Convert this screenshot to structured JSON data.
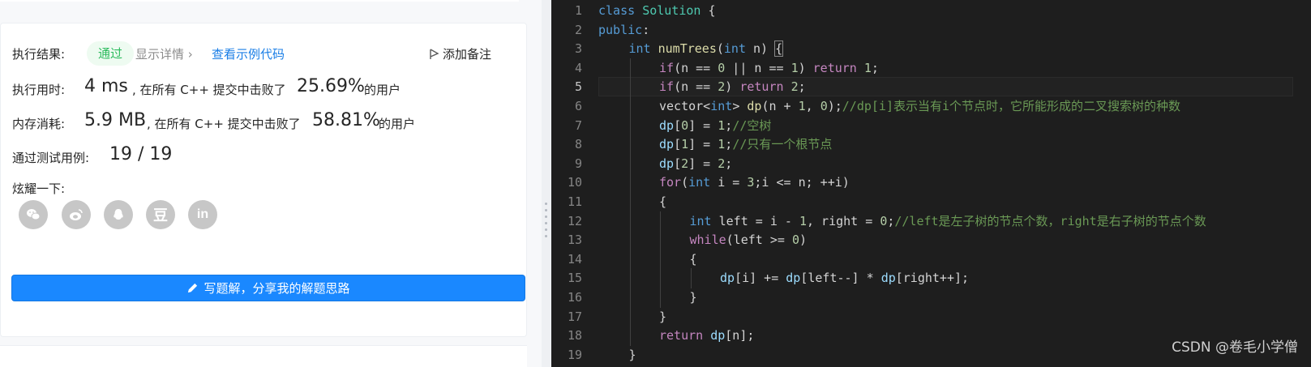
{
  "result": {
    "status_label": "执行结果:",
    "status_value": "通过",
    "details_link": "显示详情",
    "sample_code_link": "查看示例代码",
    "add_note": "添加备注",
    "runtime_label": "执行用时:",
    "runtime_value": "4 ms",
    "runtime_beat_text": ", 在所有 C++ 提交中击败了",
    "runtime_percent": "25.69%",
    "runtime_suffix": "的用户",
    "memory_label": "内存消耗:",
    "memory_value": "5.9 MB",
    "memory_beat_text": ", 在所有 C++ 提交中击败了",
    "memory_percent": "58.81%",
    "memory_suffix": "的用户",
    "tests_label": "通过测试用例:",
    "tests_value": "19 / 19",
    "share_label": "炫耀一下:",
    "share_icons": [
      "wechat-icon",
      "weibo-icon",
      "qq-icon",
      "douban-icon",
      "linkedin-icon"
    ],
    "share_douban_char": "豆",
    "share_linkedin_text": "in",
    "write_solution_button": "写题解，分享我的解题思路"
  },
  "editor": {
    "watermark": "CSDN @卷毛小学僧",
    "colors": {
      "background": "#1e1e1e",
      "keyword": "#569cd6",
      "control": "#c586c0",
      "comment": "#6a9955"
    },
    "lines": [
      {
        "n": "1",
        "indent": 0,
        "tokens": [
          [
            "kw",
            "class"
          ],
          [
            "",
            "",
            " "
          ],
          [
            "ty",
            "Solution"
          ],
          [
            "",
            "",
            " {"
          ]
        ]
      },
      {
        "n": "2",
        "indent": 0,
        "tokens": [
          [
            "kw",
            "public"
          ],
          [
            "",
            ":"
          ]
        ]
      },
      {
        "n": "3",
        "indent": 1,
        "tokens": [
          [
            "kw",
            "int"
          ],
          [
            "",
            " "
          ],
          [
            "fn",
            "numTrees"
          ],
          [
            "",
            "("
          ],
          [
            "kw",
            "int"
          ],
          [
            "",
            " n) "
          ],
          [
            "bm",
            "{"
          ]
        ]
      },
      {
        "n": "4",
        "indent": 2,
        "tokens": [
          [
            "ctl",
            "if"
          ],
          [
            "",
            "(n == "
          ],
          [
            "num",
            "0"
          ],
          [
            "",
            " || n == "
          ],
          [
            "num",
            "1"
          ],
          [
            "",
            ") "
          ],
          [
            "ctl",
            "return"
          ],
          [
            "",
            " "
          ],
          [
            "num",
            "1"
          ],
          [
            "",
            ";"
          ]
        ]
      },
      {
        "n": "5",
        "indent": 2,
        "tokens": [
          [
            "ctl",
            "if"
          ],
          [
            "",
            "(n == "
          ],
          [
            "num",
            "2"
          ],
          [
            "",
            ") "
          ],
          [
            "ctl",
            "return"
          ],
          [
            "",
            " "
          ],
          [
            "num",
            "2"
          ],
          [
            "",
            ";"
          ]
        ]
      },
      {
        "n": "6",
        "indent": 2,
        "tokens": [
          [
            "",
            "vector<"
          ],
          [
            "kw",
            "int"
          ],
          [
            "",
            "> "
          ],
          [
            "fn",
            "dp"
          ],
          [
            "",
            "(n + "
          ],
          [
            "num",
            "1"
          ],
          [
            "",
            ", "
          ],
          [
            "num",
            "0"
          ],
          [
            "",
            ");"
          ],
          [
            "cm",
            "//dp[i]表示当有i个节点时，它所能形成的二叉搜索树的种数"
          ]
        ]
      },
      {
        "n": "7",
        "indent": 2,
        "tokens": [
          [
            "var",
            "dp"
          ],
          [
            "",
            "["
          ],
          [
            "num",
            "0"
          ],
          [
            "",
            "] = "
          ],
          [
            "num",
            "1"
          ],
          [
            "",
            ";"
          ],
          [
            "cm",
            "//空树"
          ]
        ]
      },
      {
        "n": "8",
        "indent": 2,
        "tokens": [
          [
            "var",
            "dp"
          ],
          [
            "",
            "["
          ],
          [
            "num",
            "1"
          ],
          [
            "",
            "] = "
          ],
          [
            "num",
            "1"
          ],
          [
            "",
            ";"
          ],
          [
            "cm",
            "//只有一个根节点"
          ]
        ]
      },
      {
        "n": "9",
        "indent": 2,
        "tokens": [
          [
            "var",
            "dp"
          ],
          [
            "",
            "["
          ],
          [
            "num",
            "2"
          ],
          [
            "",
            "] = "
          ],
          [
            "num",
            "2"
          ],
          [
            "",
            ";"
          ]
        ]
      },
      {
        "n": "10",
        "indent": 2,
        "tokens": [
          [
            "ctl",
            "for"
          ],
          [
            "",
            "("
          ],
          [
            "kw",
            "int"
          ],
          [
            "",
            " i = "
          ],
          [
            "num",
            "3"
          ],
          [
            "",
            ";i <= n; ++i)"
          ]
        ]
      },
      {
        "n": "11",
        "indent": 2,
        "tokens": [
          [
            "",
            "{"
          ]
        ]
      },
      {
        "n": "12",
        "indent": 3,
        "tokens": [
          [
            "kw",
            "int"
          ],
          [
            "",
            " left = i - "
          ],
          [
            "num",
            "1"
          ],
          [
            "",
            ", right = "
          ],
          [
            "num",
            "0"
          ],
          [
            "",
            ";"
          ],
          [
            "cm",
            "//left是左子树的节点个数，right是右子树的节点个数"
          ]
        ]
      },
      {
        "n": "13",
        "indent": 3,
        "tokens": [
          [
            "ctl",
            "while"
          ],
          [
            "",
            "(left >= "
          ],
          [
            "num",
            "0"
          ],
          [
            "",
            ")"
          ]
        ]
      },
      {
        "n": "14",
        "indent": 3,
        "tokens": [
          [
            "",
            "{"
          ]
        ]
      },
      {
        "n": "15",
        "indent": 4,
        "tokens": [
          [
            "var",
            "dp"
          ],
          [
            "",
            "[i] += "
          ],
          [
            "var",
            "dp"
          ],
          [
            "",
            "[left--] * "
          ],
          [
            "var",
            "dp"
          ],
          [
            "",
            "[right++];"
          ]
        ]
      },
      {
        "n": "16",
        "indent": 3,
        "tokens": [
          [
            "",
            "}"
          ]
        ]
      },
      {
        "n": "17",
        "indent": 2,
        "tokens": [
          [
            "",
            "}"
          ]
        ]
      },
      {
        "n": "18",
        "indent": 2,
        "tokens": [
          [
            "ctl",
            "return"
          ],
          [
            "",
            " "
          ],
          [
            "var",
            "dp"
          ],
          [
            "",
            "[n];"
          ]
        ]
      },
      {
        "n": "19",
        "indent": 1,
        "tokens": [
          [
            "",
            "}"
          ]
        ]
      }
    ]
  }
}
